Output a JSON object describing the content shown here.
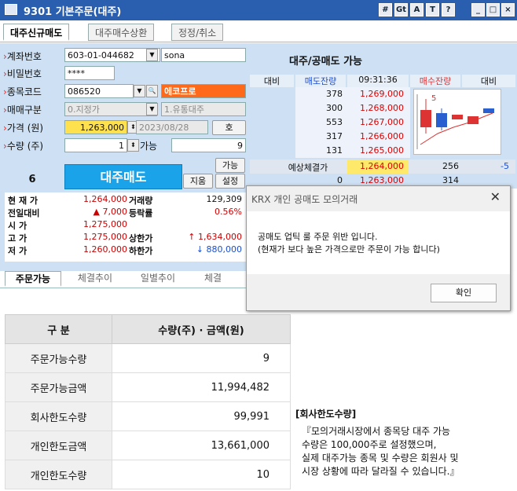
{
  "window": {
    "title": "9301 기본주문(대주)",
    "buttons": [
      "#",
      "Gt",
      "A",
      "T",
      "?",
      "_",
      "□",
      "×"
    ]
  },
  "tabs": [
    "대주신규매도",
    "대주매수상환",
    "정정/취소"
  ],
  "form": {
    "account_label": "계좌번호",
    "account_value": "603-01-044682",
    "account_name": "sona",
    "password_label": "비밀번호",
    "password_value": "****",
    "stock_label": "종목코드",
    "stock_code": "086520",
    "stock_name": "에코프로",
    "trade_type_label": "매매구분",
    "trade_type_value": "0.지정가",
    "trade_type2_value": "1.유통대주",
    "price_label": "가격 (원)",
    "price_value": "1,263,000",
    "date_value": "2023/08/28",
    "date_btn": "호",
    "qty_label": "수량 (주)",
    "qty_value": "1",
    "avail_label": "가능",
    "avail_value": "9",
    "count_value": "6",
    "submit_label": "대주매도",
    "avail_btn": "가능",
    "clear_btn": "지움",
    "settings_btn": "설정"
  },
  "stats": {
    "rows": [
      {
        "l": "현 재 가",
        "v": "1,264,000",
        "l2": "거래량",
        "v2": "129,309"
      },
      {
        "l": "전일대비",
        "v": "▲ 7,000",
        "l2": "등락률",
        "v2": "0.56%"
      },
      {
        "l": "시  가",
        "v": "1,275,000",
        "l2": "",
        "v2": ""
      },
      {
        "l": "고  가",
        "v": "1,275,000",
        "l2": "상한가",
        "v2": "↑ 1,634,000"
      },
      {
        "l": "저  가",
        "v": "1,260,000",
        "l2": "하한가",
        "v2": "↓ 880,000"
      }
    ]
  },
  "orderbook": {
    "title": "대주/공매도 가능",
    "headers": [
      "대비",
      "매도잔량",
      "09:31:36",
      "매수잔량",
      "대비"
    ],
    "asks": [
      {
        "qty": "378",
        "price": "1,269,000"
      },
      {
        "qty": "300",
        "price": "1,268,000"
      },
      {
        "qty": "553",
        "price": "1,267,000"
      },
      {
        "qty": "317",
        "price": "1,266,000"
      },
      {
        "qty": "131",
        "price": "1,265,000"
      }
    ],
    "expected_label": "예상체결가",
    "expected_price": "1,264,000",
    "expected_qty": "256",
    "expected_diff": "-5",
    "bid_row": {
      "qty_left": "0",
      "price": "1,263,000",
      "qty_right": "314"
    },
    "chart_label": "5"
  },
  "dialog": {
    "title": "KRX 개인 공매도 모의거래",
    "close": "✕",
    "line1": "공매도 업틱 룰 주문 위반 입니다.",
    "line2": "(현재가 보다 높은 가격으로만 주문이 가능 합니다)",
    "ok": "확인"
  },
  "tabs2": [
    "주문가능",
    "체결추이",
    "일별추이",
    "체결"
  ],
  "table": {
    "headers": [
      "구  분",
      "수량(주) · 금액(원)"
    ],
    "rows": [
      {
        "k": "주문가능수량",
        "v": "9"
      },
      {
        "k": "주문가능금액",
        "v": "11,994,482"
      },
      {
        "k": "회사한도수량",
        "v": "99,991"
      },
      {
        "k": "개인한도금액",
        "v": "13,661,000"
      },
      {
        "k": "개인한도수량",
        "v": "10"
      }
    ]
  },
  "note": {
    "heading": "[회사한도수량]",
    "lines": [
      "『모의거래시장에서 종목당 대주 가능",
      "  수량은 100,000주로 설정했으며,",
      "실제 대주가능 종목 및 수량은 회원사 및",
      "시장 상황에 따라 달라질 수 있습니다.』"
    ]
  }
}
